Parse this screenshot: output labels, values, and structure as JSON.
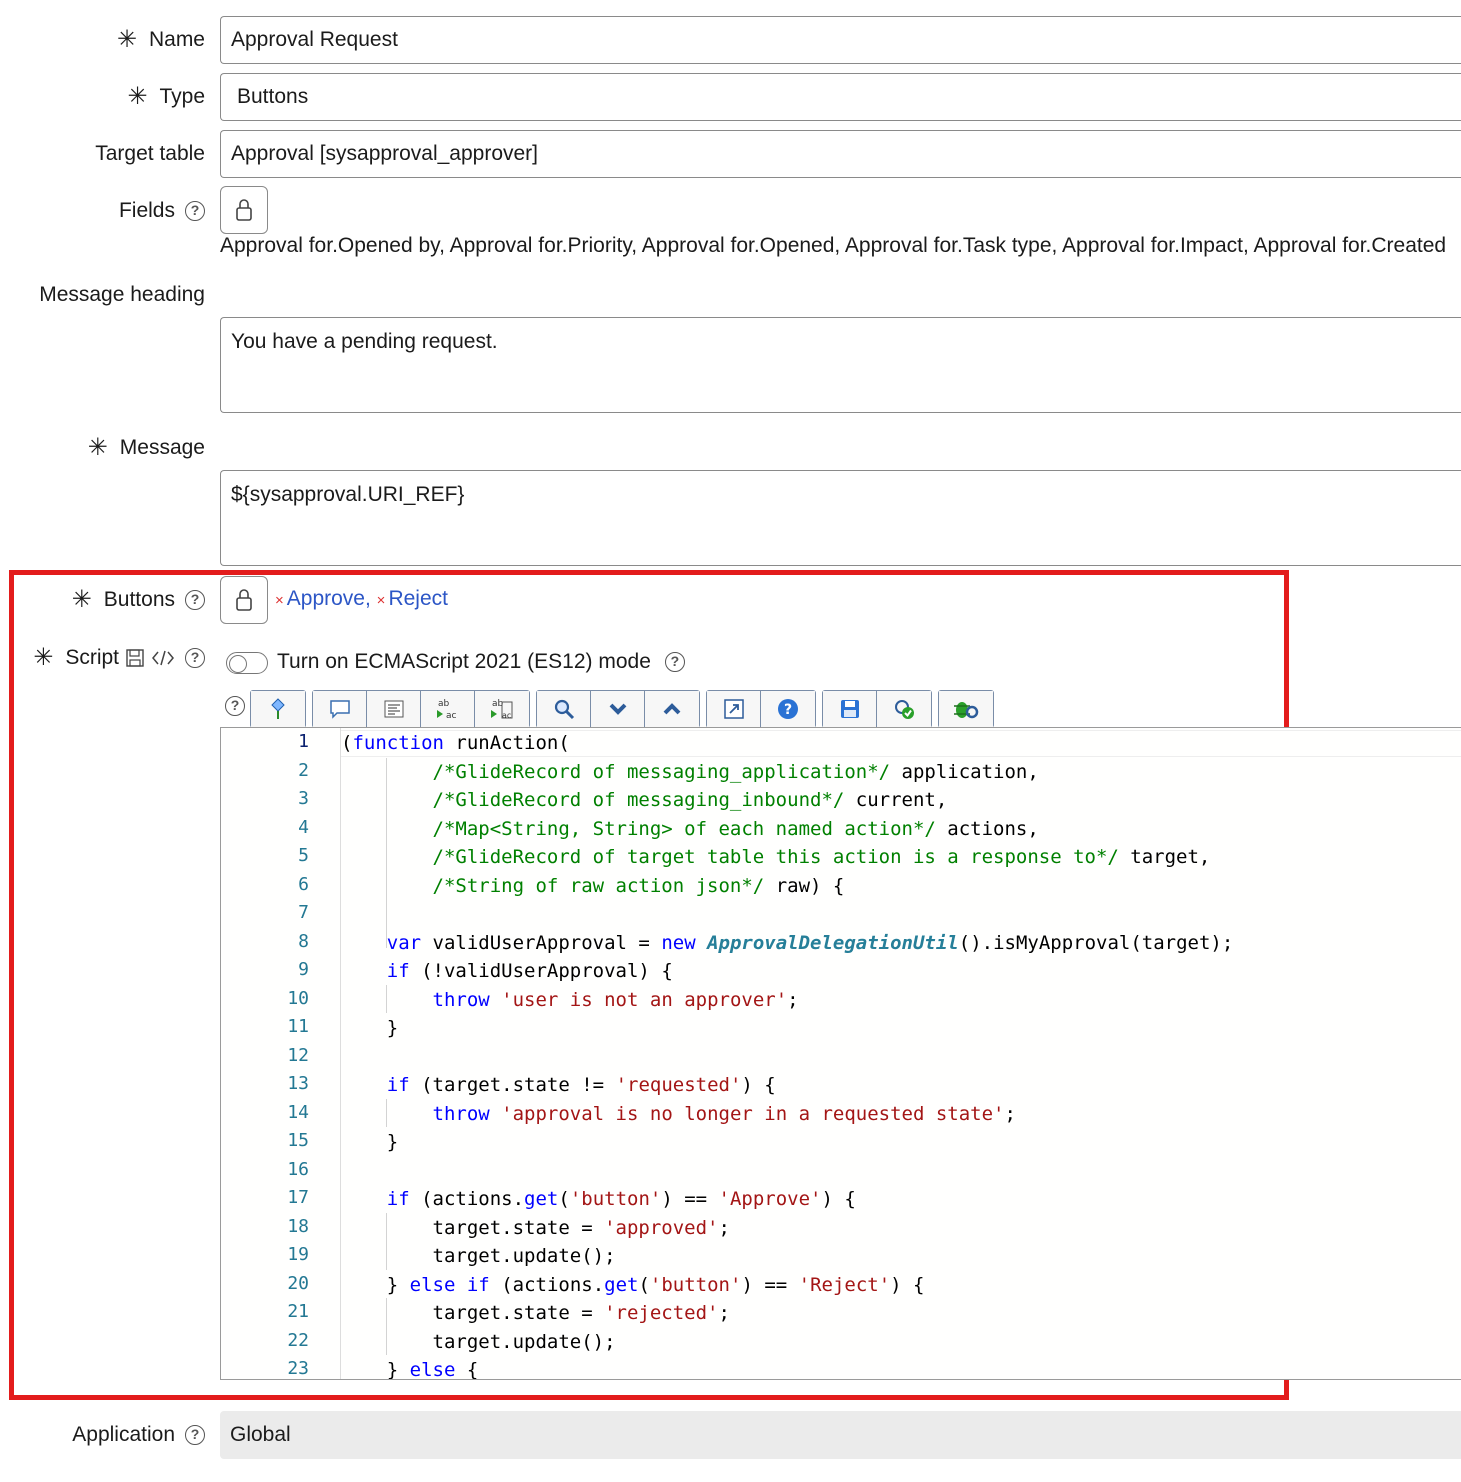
{
  "form": {
    "name": {
      "label": "Name",
      "value": "Approval Request"
    },
    "type": {
      "label": "Type",
      "value": "Buttons"
    },
    "target_table": {
      "label": "Target table",
      "value": "Approval [sysapproval_approver]"
    },
    "fields": {
      "label": "Fields",
      "value": "Approval for.Opened by, Approval for.Priority, Approval for.Opened, Approval for.Task type, Approval for.Impact, Approval for.Created"
    },
    "message_heading": {
      "label": "Message heading",
      "value": "You have a pending request."
    },
    "message": {
      "label": "Message",
      "value": "${sysapproval.URI_REF}"
    },
    "buttons": {
      "label": "Buttons",
      "chips": [
        "Approve",
        "Reject"
      ],
      "separator": ","
    },
    "script": {
      "label": "Script",
      "es_toggle_label": "Turn on ECMAScript 2021 (ES12) mode"
    },
    "application": {
      "label": "Application",
      "value": "Global"
    }
  },
  "toolbar_icons": [
    [
      "format-code-icon"
    ],
    [
      "comment-icon",
      "align-icon",
      "replace-icon",
      "replace-all-icon"
    ],
    [
      "search-icon",
      "next-icon",
      "previous-icon"
    ],
    [
      "fullscreen-icon",
      "help-icon"
    ],
    [
      "save-icon",
      "check-syntax-icon"
    ],
    [
      "debug-icon"
    ]
  ],
  "colors": {
    "highlight_border": "#e31c1c",
    "link": "#2c56c6",
    "keyword": "#0000ff",
    "comment": "#008000",
    "string": "#a31515"
  },
  "code_lines": [
    "(function runAction(",
    "        /*GlideRecord of messaging_application*/ application,",
    "        /*GlideRecord of messaging_inbound*/ current,",
    "        /*Map<String, String> of each named action*/ actions,",
    "        /*GlideRecord of target table this action is a response to*/ target,",
    "        /*String of raw action json*/ raw) {",
    "",
    "    var validUserApproval = new ApprovalDelegationUtil().isMyApproval(target);",
    "    if (!validUserApproval) {",
    "        throw 'user is not an approver';",
    "    }",
    "",
    "    if (target.state != 'requested') {",
    "        throw 'approval is no longer in a requested state';",
    "    }",
    "",
    "    if (actions.get('button') == 'Approve') {",
    "        target.state = 'approved';",
    "        target.update();",
    "    } else if (actions.get('button') == 'Reject') {",
    "        target.state = 'rejected';",
    "        target.update();",
    "    } else {"
  ]
}
